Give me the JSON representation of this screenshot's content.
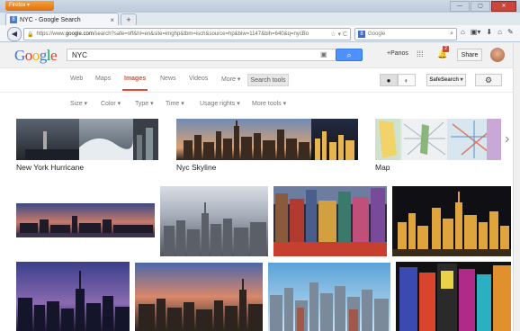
{
  "browser": {
    "menu_button": "Firefox",
    "tab_title": "NYC - Google Search",
    "tab_close": "×",
    "new_tab": "+",
    "url_prefix": "https://www.",
    "url_domain": "google.com",
    "url_rest": "/search?safe=off&hl=en&site=imghp&tbm=isch&source=hp&biw=1147&bih=640&q=nycBo",
    "url_icons": "☆ ▾ C",
    "search_engine_badge": "8",
    "search_placeholder": "Google",
    "back_glyph": "◀",
    "window_controls": [
      "—",
      "▢",
      "✕"
    ],
    "nav_icons": [
      "⌂",
      "▣▾",
      "⬇",
      "⌂",
      "✎"
    ]
  },
  "google": {
    "logo_letters": [
      "G",
      "o",
      "o",
      "g",
      "l",
      "e"
    ],
    "logo_colors": [
      "#3f78d6",
      "#dc3d2f",
      "#f4b400",
      "#3f78d6",
      "#0f9d58",
      "#dc3d2f"
    ],
    "query": "NYC",
    "search_glyph": "🔍",
    "camera_glyph": "📷",
    "user_link": "+Panos",
    "apps_glyph": "⋮⋮⋮",
    "notification_glyph": "🔔",
    "notification_count": "2",
    "share_label": "Share",
    "tabs": [
      "Web",
      "Maps",
      "Images",
      "News",
      "Videos",
      "More ▾"
    ],
    "search_tools_label": "Search tools",
    "person_glyph": "👤",
    "globe_glyph": "◐",
    "safesearch_label": "SafeSearch ▾",
    "settings_glyph": "⚙",
    "tools": [
      "Size ▾",
      "Color ▾",
      "Type ▾",
      "Time ▾",
      "Usage rights ▾",
      "More tools ▾"
    ]
  },
  "results": {
    "related": [
      {
        "caption": "New York Hurricane"
      },
      {
        "caption": "Nyc Skyline"
      },
      {
        "caption": "Map"
      }
    ],
    "next_arrow": "›"
  },
  "colors": {
    "accent_red": "#dd4b39",
    "search_blue": "#4d90fe"
  }
}
